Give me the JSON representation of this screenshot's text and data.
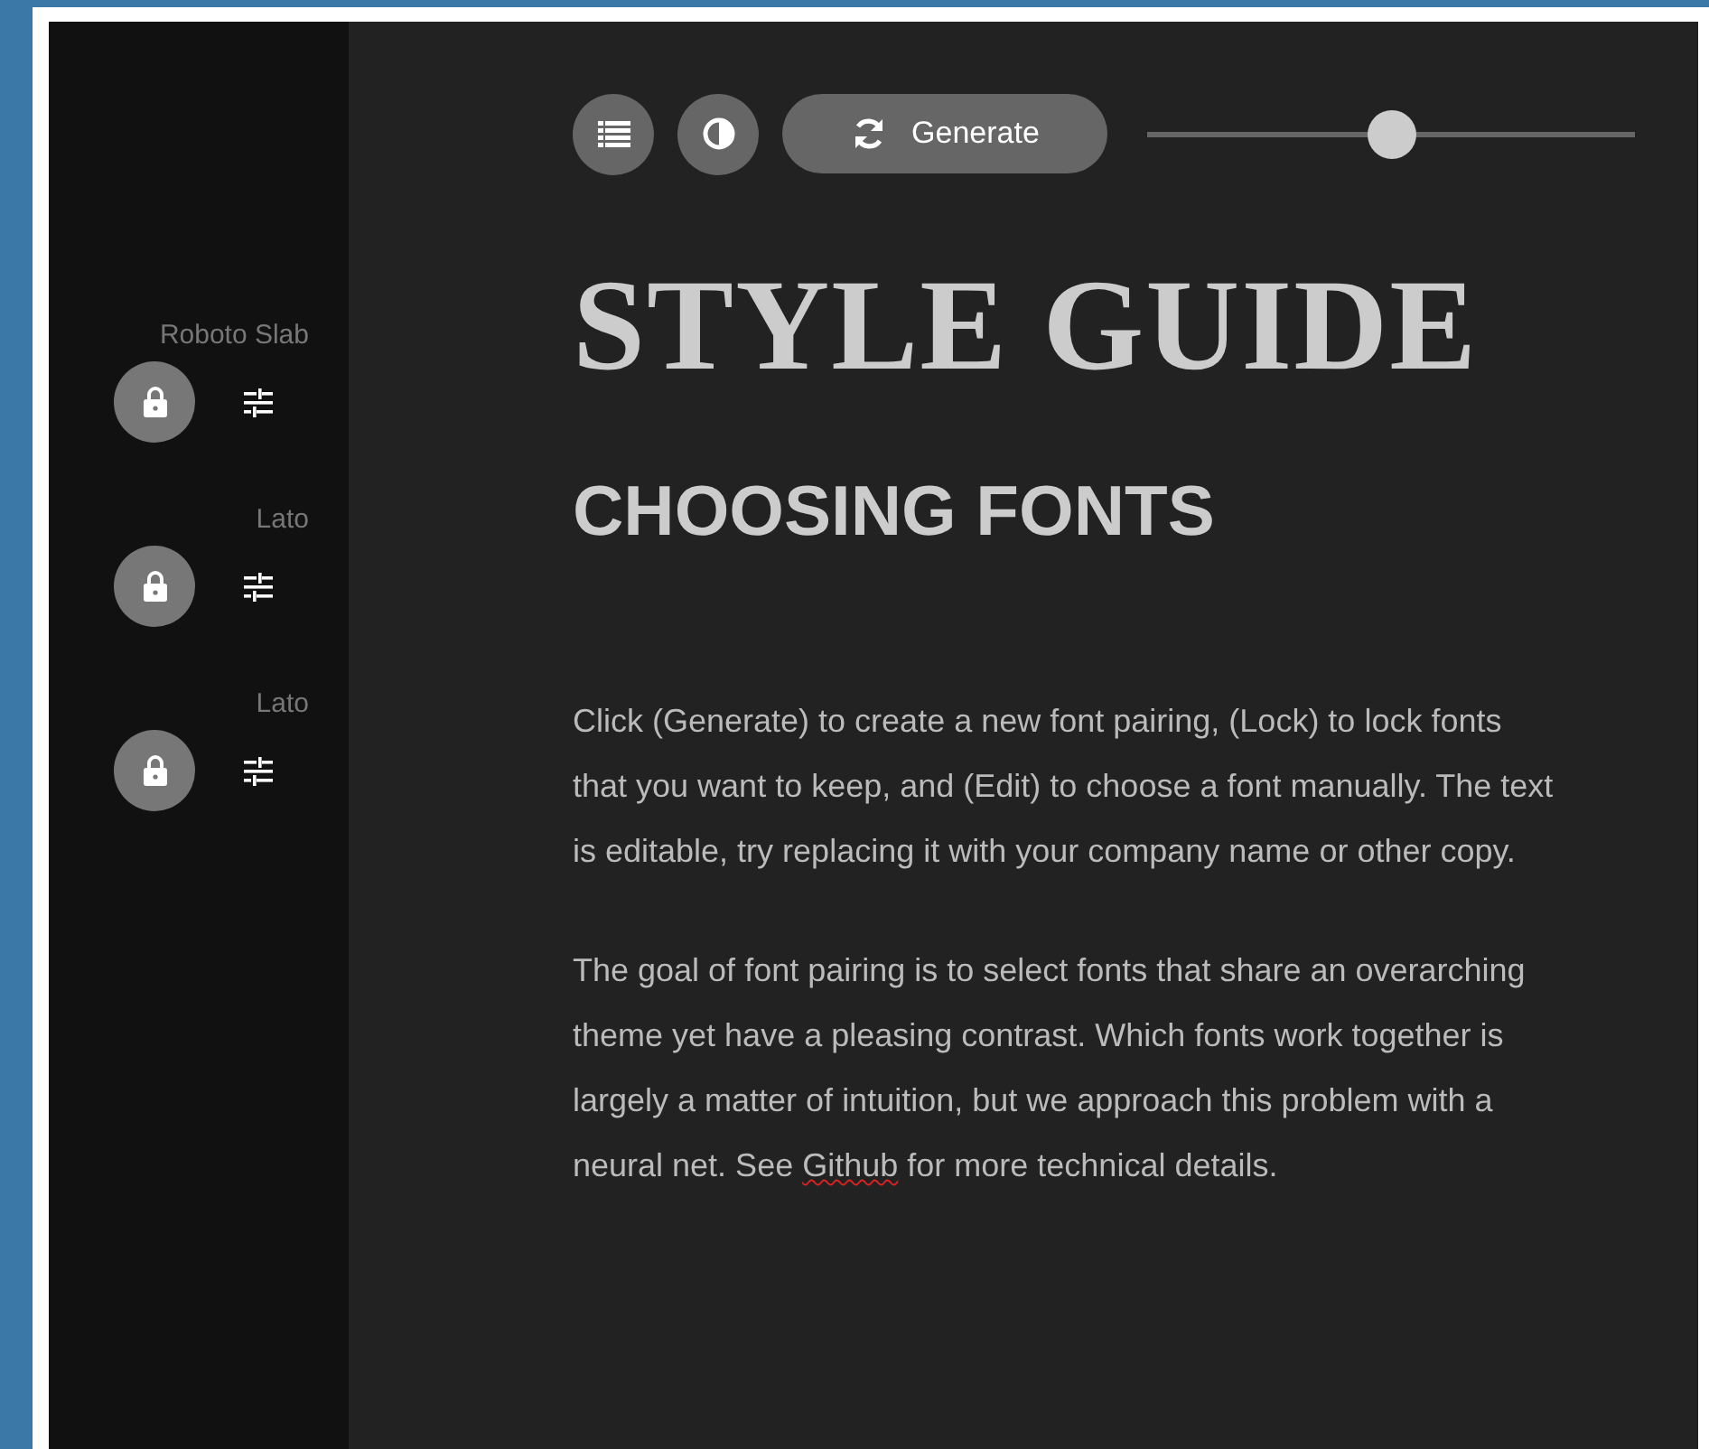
{
  "toolbar": {
    "generate_label": "Generate",
    "slider": {
      "level": 0.5
    }
  },
  "fonts": [
    {
      "name": "Roboto Slab"
    },
    {
      "name": "Lato"
    },
    {
      "name": "Lato"
    }
  ],
  "title": "STYLE GUIDE",
  "subtitle": "CHOOSING FONTS",
  "paragraphs": [
    {
      "text": "Click (Generate) to create a new font pairing, (Lock) to lock fonts that you want to keep, and (Edit) to choose a font manually. The text is editable, try replacing it with your company name or other copy."
    },
    {
      "text": "The goal of font pairing is to select fonts that share an overarching theme yet have a pleasing contrast. Which fonts work together is largely a matter of intuition, but we approach this problem with a neural net. See ",
      "link": "Github",
      "text_after": " for more technical details."
    }
  ]
}
